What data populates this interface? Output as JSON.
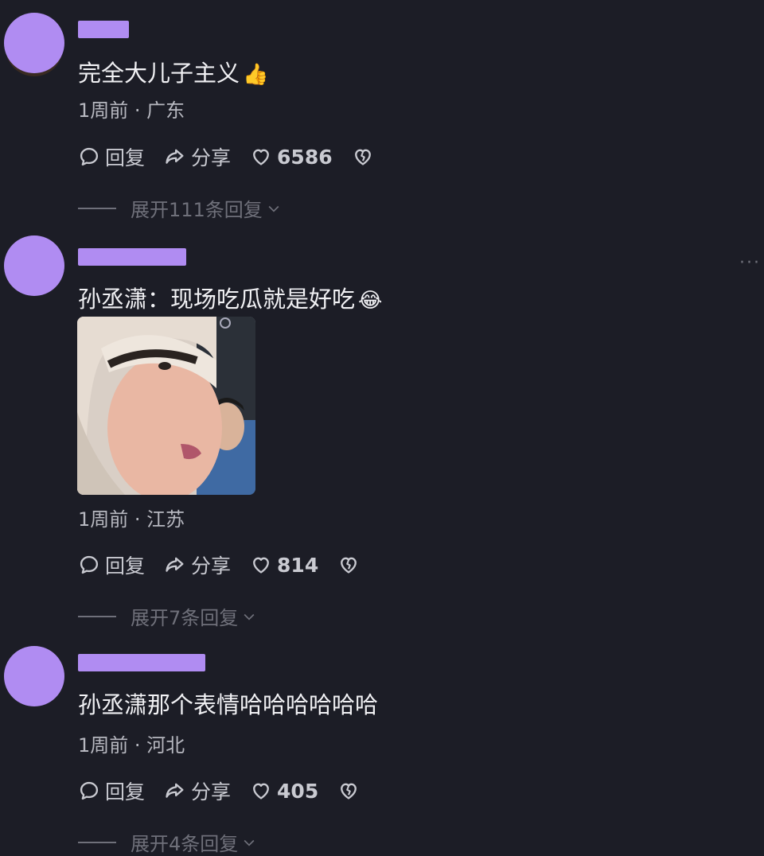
{
  "comments": [
    {
      "content": "完全大儿子主义",
      "emoji": "👍",
      "meta": "1周前 · 广东",
      "reply_label": "回复",
      "share_label": "分享",
      "likes": "6586",
      "expand_label": "展开111条回复"
    },
    {
      "content": "孙丞潇：现场吃瓜就是好吃",
      "emoji": "😂",
      "meta": "1周前 · 江苏",
      "reply_label": "回复",
      "share_label": "分享",
      "likes": "814",
      "expand_label": "展开7条回复"
    },
    {
      "content": "孙丞潇那个表情哈哈哈哈哈哈",
      "emoji": "",
      "meta": "1周前 · 河北",
      "reply_label": "回复",
      "share_label": "分享",
      "likes": "405",
      "expand_label": "展开4条回复"
    }
  ],
  "more_label": "···",
  "colors": {
    "background": "#1c1d26",
    "avatar_mask": "#b08cf2",
    "text_primary": "#f1f1f4",
    "text_secondary": "#b7b8c0",
    "text_muted": "#6f707a"
  },
  "icons": [
    "comment-bubble-icon",
    "share-arrow-icon",
    "heart-icon",
    "broken-heart-icon",
    "chevron-down-icon",
    "more-dots-icon"
  ]
}
